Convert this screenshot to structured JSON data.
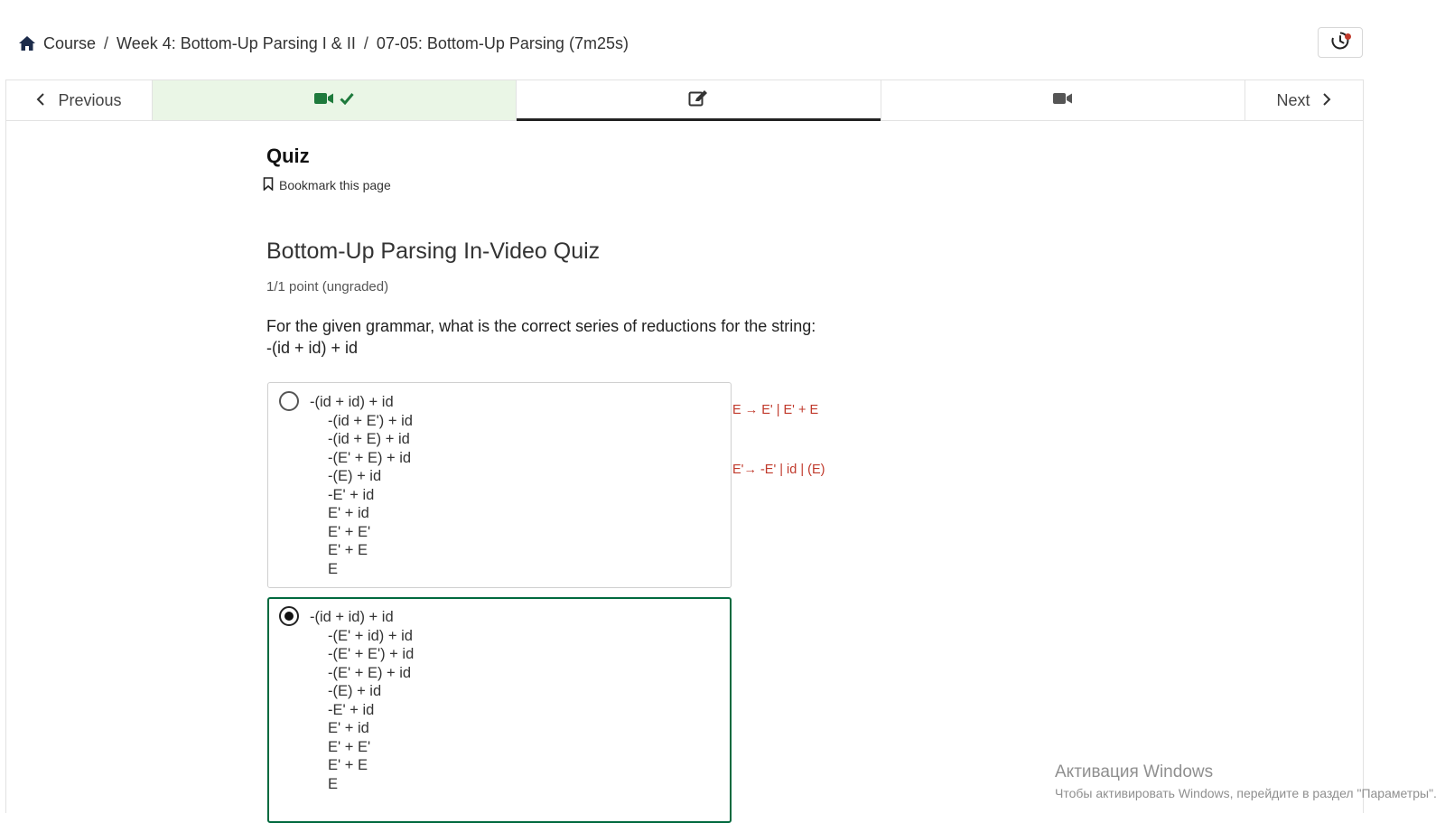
{
  "breadcrumb": {
    "course": "Course",
    "sep1": "/",
    "week": "Week 4: Bottom-Up Parsing I & II",
    "sep2": "/",
    "unit": "07-05: Bottom-Up Parsing (7m25s)"
  },
  "nav": {
    "previous_label": "Previous",
    "next_label": "Next",
    "sequence": [
      {
        "icon": "video-camera-icon",
        "state": "completed"
      },
      {
        "icon": "edit-icon",
        "state": "active"
      },
      {
        "icon": "video-camera-icon",
        "state": "default"
      }
    ]
  },
  "unit": {
    "title": "Quiz",
    "bookmark_label": "Bookmark this page"
  },
  "problem": {
    "title": "Bottom-Up Parsing In-Video Quiz",
    "points": "1/1 point (ungraded)",
    "question_line1": "For the given grammar, what is the correct series of reductions for the string:",
    "question_line2": "-(id + id) + id",
    "grammar_line1": "E → E' | E' + E",
    "grammar_line2": "E'→ -E' | id | (E)",
    "options": [
      {
        "selected": false,
        "lines": [
          "-(id + id) + id",
          "-(id + E') + id",
          "-(id + E) + id",
          "-(E' + E) + id",
          "-(E) + id",
          "-E' + id",
          "E' + id",
          "E' + E'",
          "E' + E",
          "E"
        ]
      },
      {
        "selected": true,
        "lines": [
          "-(id + id) + id",
          "-(E' + id) + id",
          "-(E' + E') + id",
          "-(E' + E) + id",
          "-(E) + id",
          "-E' + id",
          "E' + id",
          "E' + E'",
          "E' + E",
          "E"
        ]
      }
    ]
  },
  "watermark": {
    "line1": "Активация Windows",
    "line2": "Чтобы активировать Windows, перейдите в раздел \"Параметры\"."
  },
  "colors": {
    "accent_green": "#00693e",
    "completed_bg": "#eaf6e6",
    "grammar_red": "#c0392b"
  }
}
